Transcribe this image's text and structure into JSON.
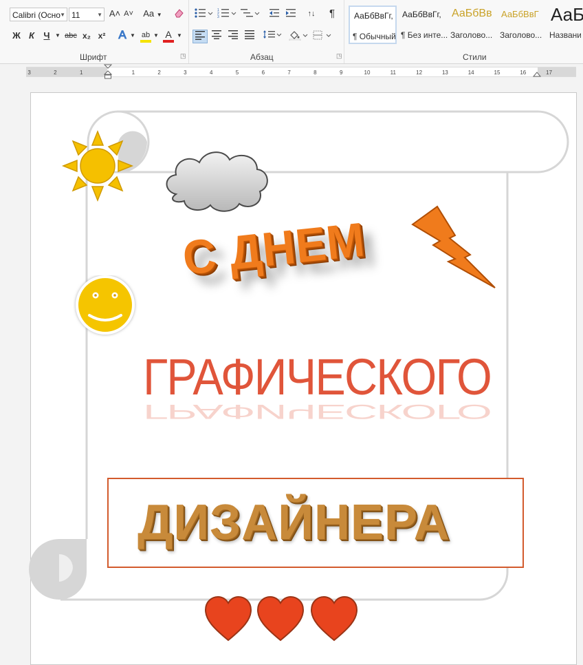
{
  "ribbon": {
    "font": {
      "label": "Шрифт",
      "font_name": "Calibri (Осно",
      "font_size": "11",
      "grow_label": "A˄",
      "shrink_label": "A˅",
      "case_label": "Aa",
      "bold": "Ж",
      "italic": "К",
      "underline": "Ч",
      "strike": "abc",
      "subscript": "x₂",
      "superscript": "x²",
      "effects": "A",
      "highlight": "ab",
      "color": "A",
      "highlight_color": "#f5e300",
      "font_color": "#e02020"
    },
    "paragraph": {
      "label": "Абзац",
      "sort": "↑↓",
      "pilcrow": "¶"
    },
    "styles": {
      "label": "Стили",
      "items": [
        {
          "sample": "АаБбВвГг,",
          "name": "¶ Обычный"
        },
        {
          "sample": "АаБбВвГг,",
          "name": "¶ Без инте..."
        },
        {
          "sample": "АаБбВв",
          "name": "Заголово..."
        },
        {
          "sample": "АаБбВвГ",
          "name": "Заголово..."
        },
        {
          "sample": "АаБ",
          "name": "Названи"
        }
      ]
    }
  },
  "ruler": {
    "left_labels": [
      "3",
      "2",
      "1"
    ],
    "right_labels": [
      "1",
      "2",
      "3",
      "4",
      "5",
      "6",
      "7",
      "8",
      "9",
      "10",
      "11",
      "12",
      "13",
      "14",
      "15",
      "16",
      "17"
    ]
  },
  "document": {
    "line1": "С ДНЕМ",
    "line2": "ГРАФИЧЕСКОГО",
    "line3": "ДИЗАЙНЕРА",
    "colors": {
      "orange": "#f07b1c",
      "red": "#e0553a",
      "bronze": "#c88a3a",
      "sun": "#f5c000",
      "heart": "#e8441e"
    }
  }
}
